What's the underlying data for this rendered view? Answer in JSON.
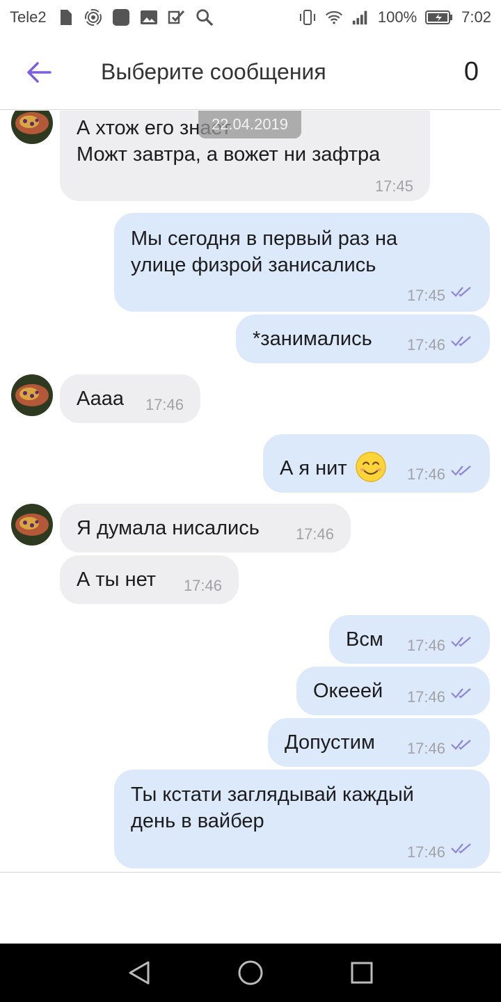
{
  "status_bar": {
    "carrier": "Tele2",
    "battery": "100%",
    "time": "7:02"
  },
  "header": {
    "title": "Выберите сообщения",
    "selected_count": "0"
  },
  "date_badge": "22.04.2019",
  "messages": [
    {
      "dir": "in",
      "lines": [
        "А хтож его знает",
        "Можт завтра, а вожет ни зафтра"
      ],
      "time": "17:45"
    },
    {
      "dir": "out",
      "lines": [
        "Мы сегодня в первый раз на",
        "улице физрой занисались"
      ],
      "time": "17:45"
    },
    {
      "dir": "out",
      "lines": [
        "*занимались"
      ],
      "time": "17:46"
    },
    {
      "dir": "in",
      "lines": [
        "Аааа"
      ],
      "time": "17:46"
    },
    {
      "dir": "out",
      "lines": [
        "А я нит"
      ],
      "time": "17:46",
      "emoji": "smiling-face-emoji"
    },
    {
      "dir": "in",
      "lines": [
        "Я думала нисались"
      ],
      "time": "17:46"
    },
    {
      "dir": "in",
      "lines": [
        "А ты нет"
      ],
      "time": "17:46"
    },
    {
      "dir": "out",
      "lines": [
        "Всм"
      ],
      "time": "17:46"
    },
    {
      "dir": "out",
      "lines": [
        "Окееей"
      ],
      "time": "17:46"
    },
    {
      "dir": "out",
      "lines": [
        "Допустим"
      ],
      "time": "17:46"
    },
    {
      "dir": "out",
      "lines": [
        "Ты кстати заглядывай каждый",
        "день в вайбер"
      ],
      "time": "17:46"
    }
  ],
  "colors": {
    "accent": "#7b5fe0",
    "incoming_bubble": "#eeedf0",
    "outgoing_bubble": "#dce9fb",
    "read_ticks": "#8e84d8"
  }
}
